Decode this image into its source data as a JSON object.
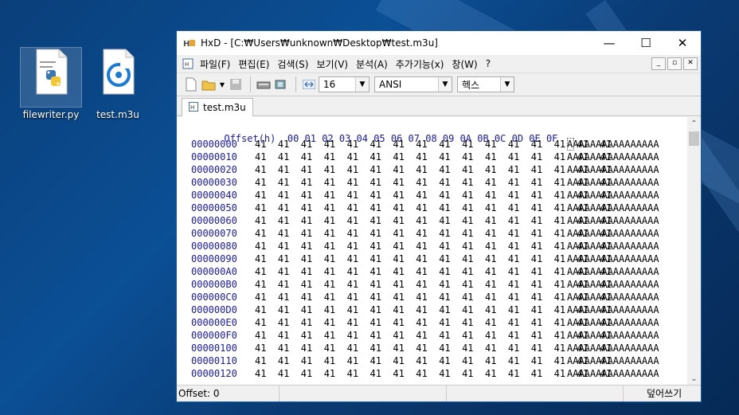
{
  "desktop": {
    "icons": [
      {
        "label": "filewriter.py",
        "icon": "python-file-icon"
      },
      {
        "label": "test.m3u",
        "icon": "groove-music-file-icon"
      }
    ]
  },
  "window": {
    "app_icon": "hxd-icon",
    "title": "HxD - [C:₩Users₩unknown₩Desktop₩test.m3u]",
    "controls": {
      "minimize": "—",
      "maximize": "☐",
      "close": "✕"
    }
  },
  "menubar": {
    "items": [
      "파일(F)",
      "편집(E)",
      "검색(S)",
      "보기(V)",
      "분석(A)",
      "추가기능(x)",
      "창(W)",
      "?"
    ]
  },
  "toolbar": {
    "bytes_per_row": "16",
    "charset": "ANSI",
    "display_mode": "헥스"
  },
  "tabs": [
    {
      "label": "test.m3u"
    }
  ],
  "editor": {
    "header_label": "Offset(h)",
    "columns": [
      "00",
      "01",
      "02",
      "03",
      "04",
      "05",
      "06",
      "07",
      "08",
      "09",
      "0A",
      "0B",
      "0C",
      "0D",
      "0E",
      "0F"
    ],
    "rows": [
      {
        "offset": "00000000",
        "hex": "41 41 41 41 41 41 41 41 41 41 41 41 41 41 41 41",
        "ascii": "AAAAAAAAAAAAAAAA"
      },
      {
        "offset": "00000010",
        "hex": "41 41 41 41 41 41 41 41 41 41 41 41 41 41 41 41",
        "ascii": "AAAAAAAAAAAAAAAA"
      },
      {
        "offset": "00000020",
        "hex": "41 41 41 41 41 41 41 41 41 41 41 41 41 41 41 41",
        "ascii": "AAAAAAAAAAAAAAAA"
      },
      {
        "offset": "00000030",
        "hex": "41 41 41 41 41 41 41 41 41 41 41 41 41 41 41 41",
        "ascii": "AAAAAAAAAAAAAAAA"
      },
      {
        "offset": "00000040",
        "hex": "41 41 41 41 41 41 41 41 41 41 41 41 41 41 41 41",
        "ascii": "AAAAAAAAAAAAAAAA"
      },
      {
        "offset": "00000050",
        "hex": "41 41 41 41 41 41 41 41 41 41 41 41 41 41 41 41",
        "ascii": "AAAAAAAAAAAAAAAA"
      },
      {
        "offset": "00000060",
        "hex": "41 41 41 41 41 41 41 41 41 41 41 41 41 41 41 41",
        "ascii": "AAAAAAAAAAAAAAAA"
      },
      {
        "offset": "00000070",
        "hex": "41 41 41 41 41 41 41 41 41 41 41 41 41 41 41 41",
        "ascii": "AAAAAAAAAAAAAAAA"
      },
      {
        "offset": "00000080",
        "hex": "41 41 41 41 41 41 41 41 41 41 41 41 41 41 41 41",
        "ascii": "AAAAAAAAAAAAAAAA"
      },
      {
        "offset": "00000090",
        "hex": "41 41 41 41 41 41 41 41 41 41 41 41 41 41 41 41",
        "ascii": "AAAAAAAAAAAAAAAA"
      },
      {
        "offset": "000000A0",
        "hex": "41 41 41 41 41 41 41 41 41 41 41 41 41 41 41 41",
        "ascii": "AAAAAAAAAAAAAAAA"
      },
      {
        "offset": "000000B0",
        "hex": "41 41 41 41 41 41 41 41 41 41 41 41 41 41 41 41",
        "ascii": "AAAAAAAAAAAAAAAA"
      },
      {
        "offset": "000000C0",
        "hex": "41 41 41 41 41 41 41 41 41 41 41 41 41 41 41 41",
        "ascii": "AAAAAAAAAAAAAAAA"
      },
      {
        "offset": "000000D0",
        "hex": "41 41 41 41 41 41 41 41 41 41 41 41 41 41 41 41",
        "ascii": "AAAAAAAAAAAAAAAA"
      },
      {
        "offset": "000000E0",
        "hex": "41 41 41 41 41 41 41 41 41 41 41 41 41 41 41 41",
        "ascii": "AAAAAAAAAAAAAAAA"
      },
      {
        "offset": "000000F0",
        "hex": "41 41 41 41 41 41 41 41 41 41 41 41 41 41 41 41",
        "ascii": "AAAAAAAAAAAAAAAA"
      },
      {
        "offset": "00000100",
        "hex": "41 41 41 41 41 41 41 41 41 41 41 41 41 41 41 41",
        "ascii": "AAAAAAAAAAAAAAAA"
      },
      {
        "offset": "00000110",
        "hex": "41 41 41 41 41 41 41 41 41 41 41 41 41 41 41 41",
        "ascii": "AAAAAAAAAAAAAAAA"
      },
      {
        "offset": "00000120",
        "hex": "41 41 41 41 41 41 41 41 41 41 41 41 41 41 41 41",
        "ascii": "AAAAAAAAAAAAAAAA"
      }
    ]
  },
  "statusbar": {
    "offset": "Offset: 0",
    "mode": "덮어쓰기"
  }
}
